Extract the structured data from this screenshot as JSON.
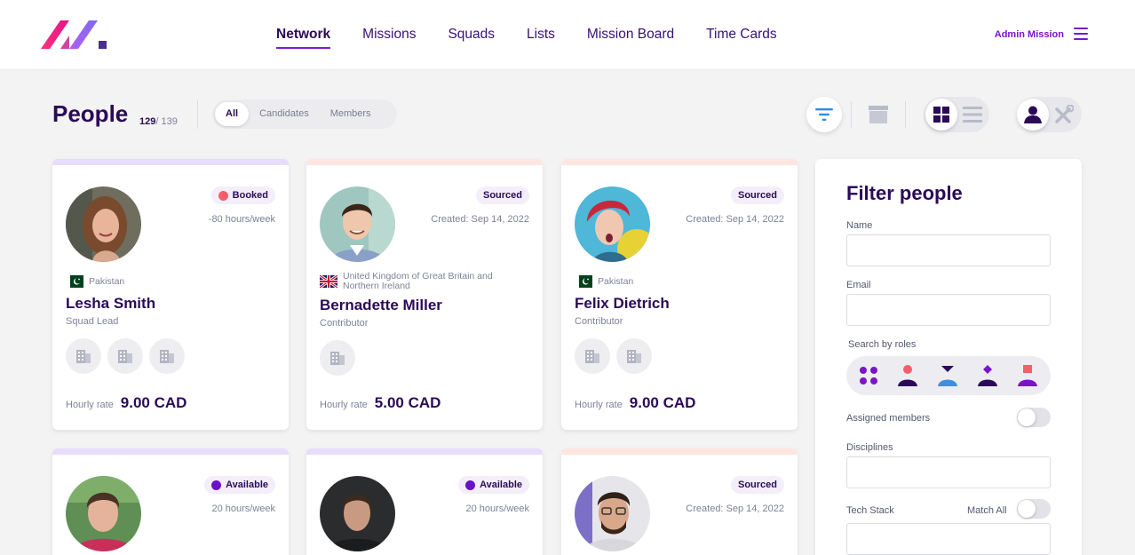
{
  "nav": {
    "items": [
      "Network",
      "Missions",
      "Squads",
      "Lists",
      "Mission Board",
      "Time Cards"
    ],
    "active": "Network",
    "admin_label": "Admin Mission"
  },
  "page": {
    "title": "People",
    "count_shown": "129",
    "count_total": "/ 139",
    "tabs": [
      "All",
      "Candidates",
      "Members"
    ],
    "active_tab": "All"
  },
  "toolbar": {
    "icons": [
      "filter-icon",
      "archive-icon",
      "grid-view-icon",
      "list-view-icon",
      "person-icon",
      "tools-icon"
    ],
    "accent": "#7b14c8"
  },
  "colors": {
    "booked": "#f25f6a",
    "available": "#6b12c9",
    "stripe_purple": "#e6dcfb",
    "stripe_peach": "#fde6df"
  },
  "cards": [
    {
      "status": "Booked",
      "sub": "-80 hours/week",
      "country": "Pakistan",
      "name": "Lesha Smith",
      "role": "Squad Lead",
      "rate_label": "Hourly rate",
      "rate": "9.00 CAD"
    },
    {
      "status": "Sourced",
      "sub": "Created: Sep 14, 2022",
      "country": "United Kingdom of Great Britain and Northern Ireland",
      "name": "Bernadette Miller",
      "role": "Contributor",
      "rate_label": "Hourly rate",
      "rate": "5.00 CAD"
    },
    {
      "status": "Sourced",
      "sub": "Created: Sep 14, 2022",
      "country": "Pakistan",
      "name": "Felix Dietrich",
      "role": "Contributor",
      "rate_label": "Hourly rate",
      "rate": "9.00 CAD"
    },
    {
      "status": "Available",
      "sub": "20 hours/week"
    },
    {
      "status": "Available",
      "sub": "20 hours/week"
    },
    {
      "status": "Sourced",
      "sub": "Created: Sep 14, 2022"
    }
  ],
  "filter": {
    "title": "Filter people",
    "name_label": "Name",
    "email_label": "Email",
    "roles_label": "Search by roles",
    "assigned_label": "Assigned members",
    "disciplines_label": "Disciplines",
    "tech_label": "Tech Stack",
    "match_label": "Match All"
  }
}
